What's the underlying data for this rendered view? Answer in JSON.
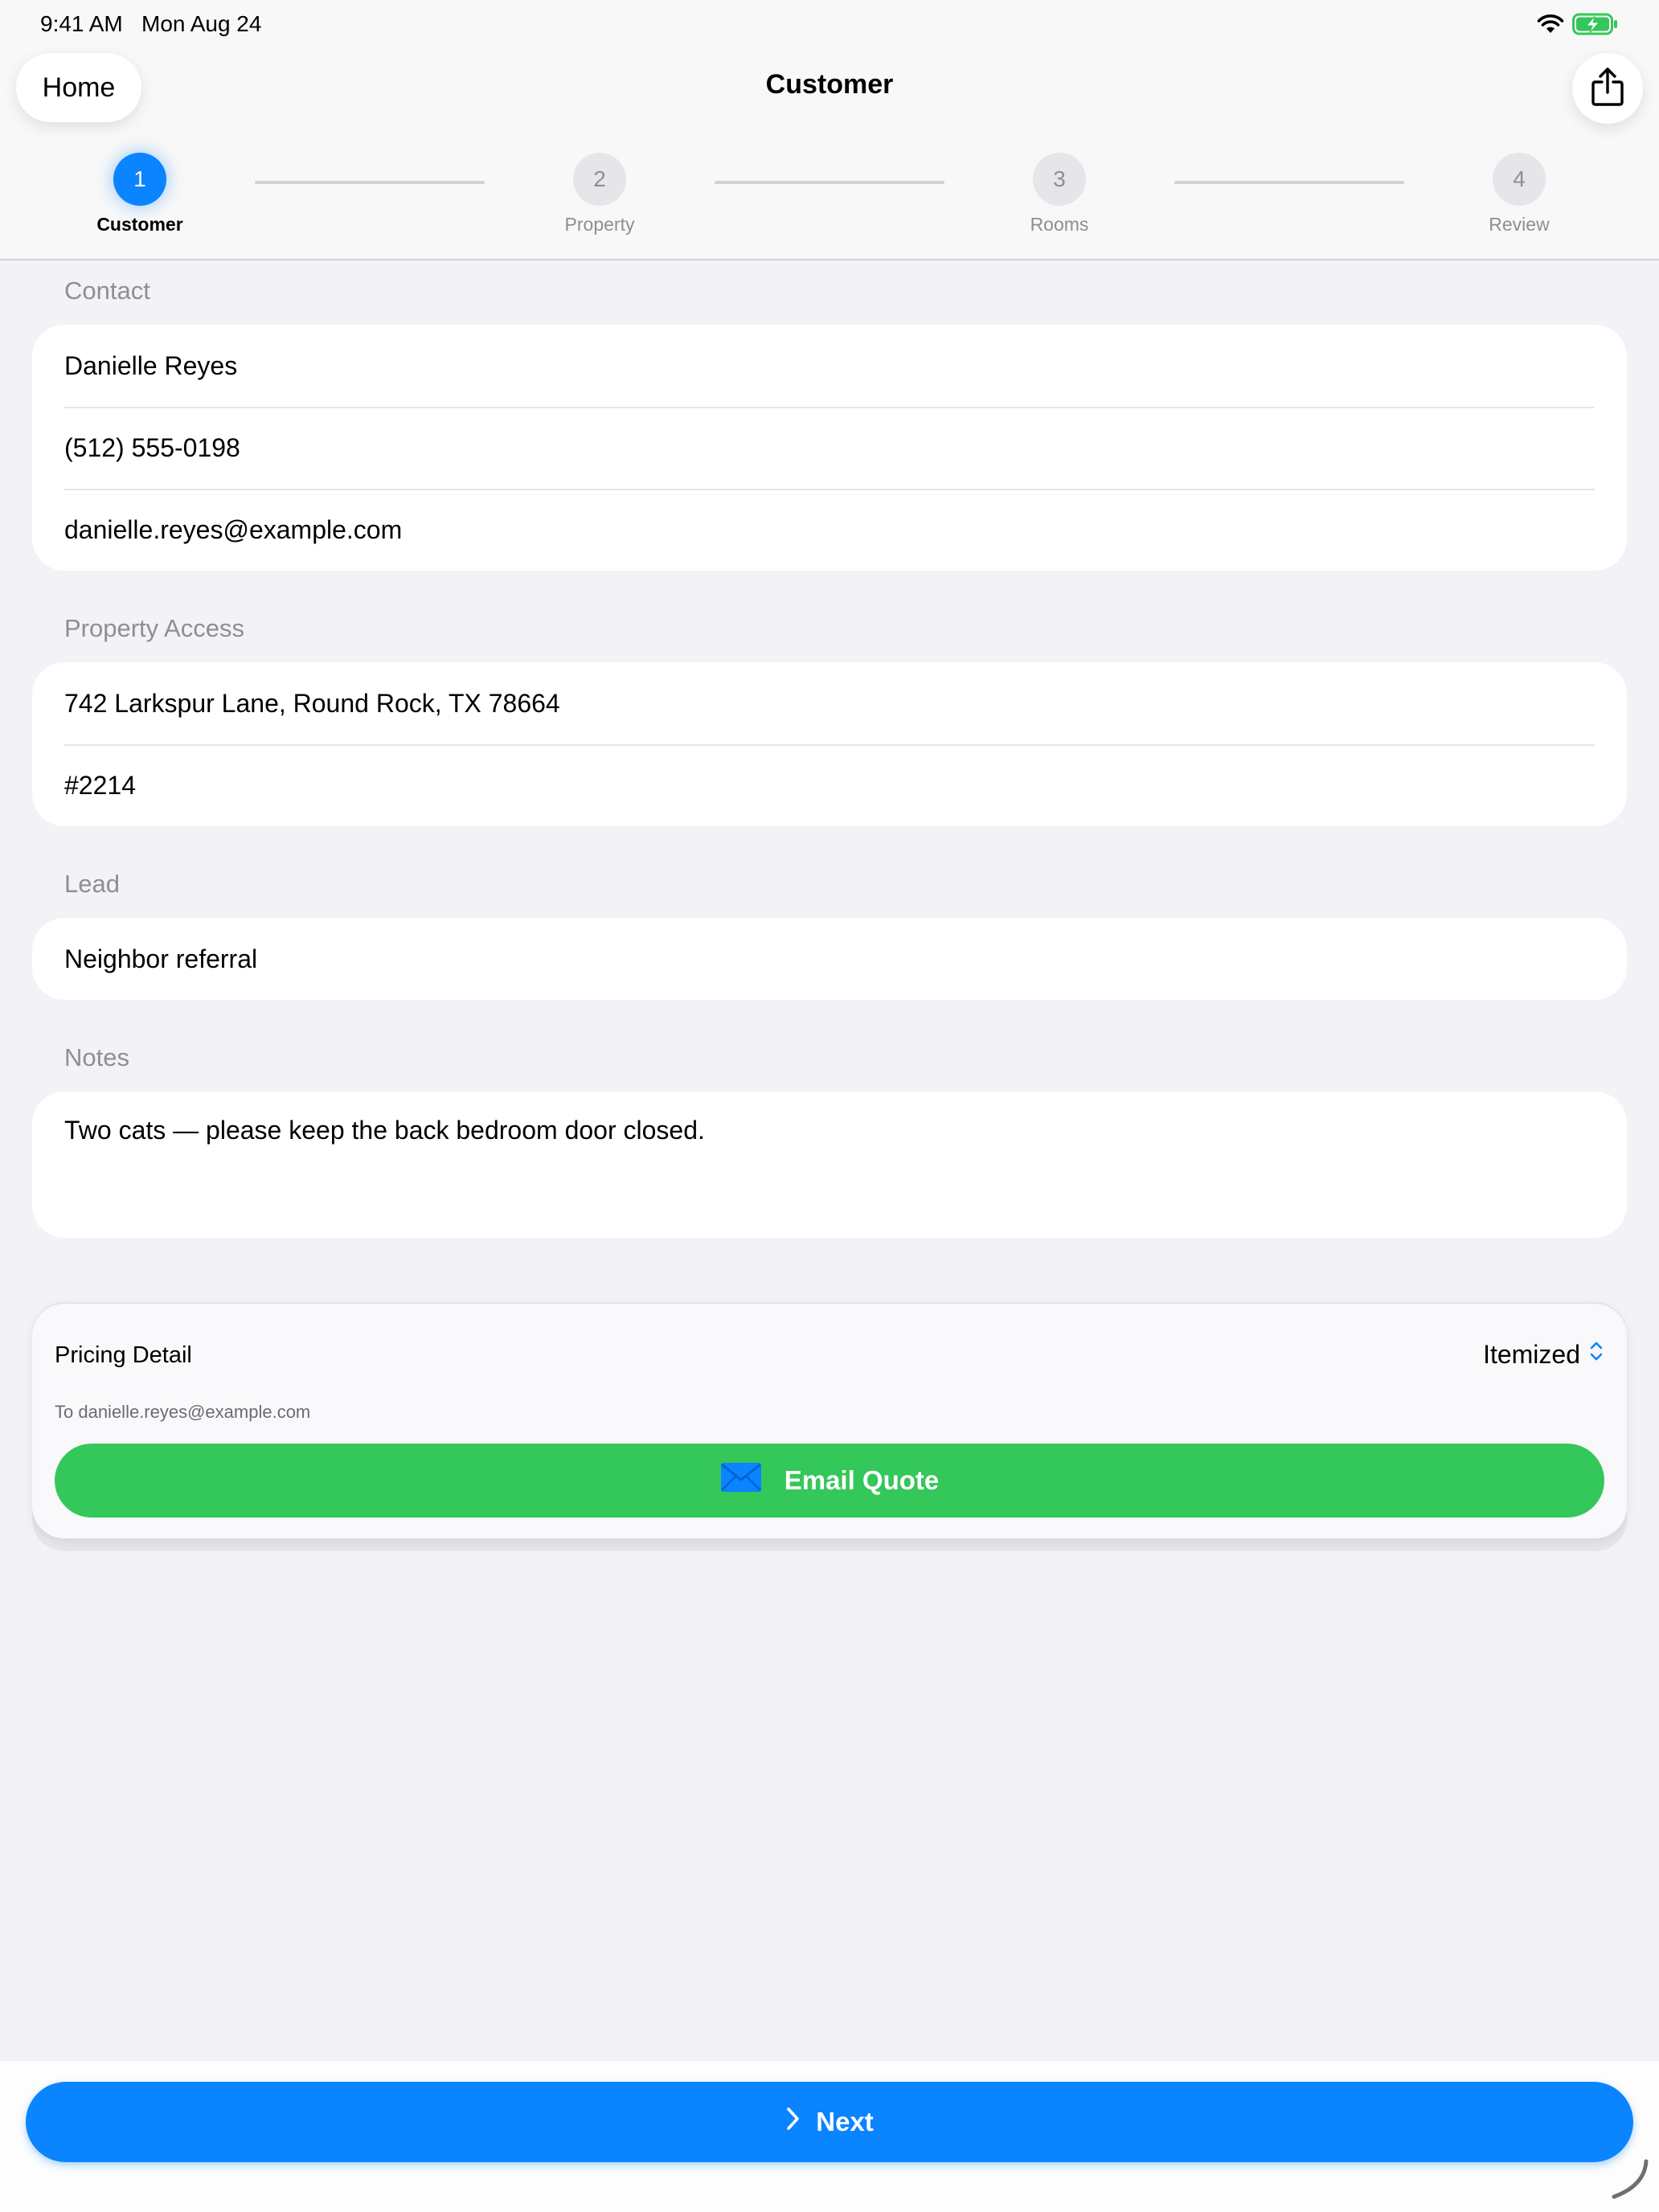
{
  "status_bar": {
    "time": "9:41 AM",
    "date": "Mon Aug 24",
    "wifi_icon": "wifi-icon",
    "battery_icon": "battery-charging-icon"
  },
  "nav": {
    "back_label": "Home",
    "title": "Customer",
    "share_icon": "share-icon"
  },
  "stepper": {
    "steps": [
      {
        "number": "1",
        "label": "Customer",
        "active": true
      },
      {
        "number": "2",
        "label": "Property",
        "active": false
      },
      {
        "number": "3",
        "label": "Rooms",
        "active": false
      },
      {
        "number": "4",
        "label": "Review",
        "active": false
      }
    ]
  },
  "form": {
    "contact": {
      "header": "Contact",
      "name": "Danielle Reyes",
      "phone": "(512) 555-0198",
      "email": "danielle.reyes@example.com"
    },
    "property_access": {
      "header": "Property Access",
      "address": "742 Larkspur Lane, Round Rock, TX 78664",
      "access_code": "#2214"
    },
    "lead": {
      "header": "Lead",
      "source": "Neighbor referral"
    },
    "notes": {
      "header": "Notes",
      "text": "Two cats — please keep the back bedroom door closed."
    }
  },
  "pricing": {
    "title": "Pricing Detail",
    "selected_option": "Itemized",
    "recipient_line": "To danielle.reyes@example.com",
    "email_button_label": "Email Quote",
    "email_icon": "envelope-icon"
  },
  "footer": {
    "next_label": "Next",
    "next_icon": "chevron-right-icon"
  },
  "colors": {
    "accent_blue": "#0a84ff",
    "success_green": "#34c759",
    "background": "#f2f2f7"
  }
}
